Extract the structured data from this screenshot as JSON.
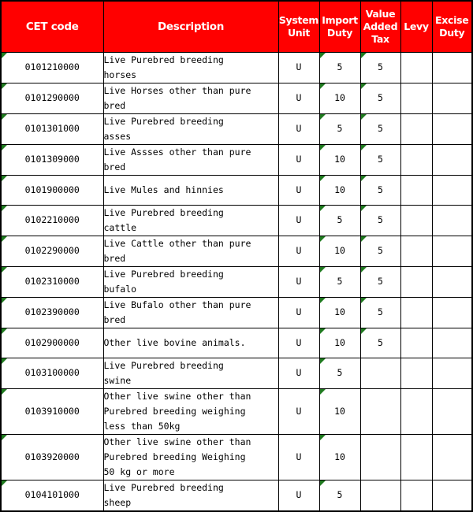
{
  "table": {
    "accent_color": "#FF0000",
    "header_text_color": "#FFFFFF",
    "border_color": "#000000",
    "error_flag_color": "#1F7A1F",
    "columns": [
      {
        "key": "cet_code",
        "label": "CET code"
      },
      {
        "key": "description",
        "label": "Description"
      },
      {
        "key": "system_unit",
        "label": "System Unit"
      },
      {
        "key": "import_duty",
        "label": "Import Duty"
      },
      {
        "key": "vat",
        "label": "Value Added Tax"
      },
      {
        "key": "levy",
        "label": "Levy"
      },
      {
        "key": "excise_duty",
        "label": "Excise Duty"
      }
    ],
    "rows": [
      {
        "cet_code": "0101210000",
        "description": "Live Purebred breeding\nhorses",
        "system_unit": "U",
        "import_duty": "5",
        "vat": "5",
        "levy": "",
        "excise_duty": ""
      },
      {
        "cet_code": "0101290000",
        "description": "Live Horses other than pure\nbred",
        "system_unit": "U",
        "import_duty": "10",
        "vat": "5",
        "levy": "",
        "excise_duty": ""
      },
      {
        "cet_code": "0101301000",
        "description": "Live Purebred breeding\nasses",
        "system_unit": "U",
        "import_duty": "5",
        "vat": "5",
        "levy": "",
        "excise_duty": ""
      },
      {
        "cet_code": "0101309000",
        "description": "Live Assses other than pure\nbred",
        "system_unit": "U",
        "import_duty": "10",
        "vat": "5",
        "levy": "",
        "excise_duty": ""
      },
      {
        "cet_code": "0101900000",
        "description": "Live Mules and hinnies",
        "system_unit": "U",
        "import_duty": "10",
        "vat": "5",
        "levy": "",
        "excise_duty": ""
      },
      {
        "cet_code": "0102210000",
        "description": "Live Purebred breeding\ncattle",
        "system_unit": "U",
        "import_duty": "5",
        "vat": "5",
        "levy": "",
        "excise_duty": ""
      },
      {
        "cet_code": "0102290000",
        "description": "Live Cattle other than pure\nbred",
        "system_unit": "U",
        "import_duty": "10",
        "vat": "5",
        "levy": "",
        "excise_duty": ""
      },
      {
        "cet_code": "0102310000",
        "description": "Live Purebred breeding\nbufalo",
        "system_unit": "U",
        "import_duty": "5",
        "vat": "5",
        "levy": "",
        "excise_duty": ""
      },
      {
        "cet_code": "0102390000",
        "description": "Live Bufalo other than pure\nbred",
        "system_unit": "U",
        "import_duty": "10",
        "vat": "5",
        "levy": "",
        "excise_duty": ""
      },
      {
        "cet_code": "0102900000",
        "description": "Other live bovine animals.",
        "system_unit": "U",
        "import_duty": "10",
        "vat": "5",
        "levy": "",
        "excise_duty": ""
      },
      {
        "cet_code": "0103100000",
        "description": "Live Purebred breeding\nswine",
        "system_unit": "U",
        "import_duty": "5",
        "vat": "",
        "levy": "",
        "excise_duty": ""
      },
      {
        "cet_code": "0103910000",
        "description": "Other live swine other than\nPurebred breeding weighing\nless than 50kg",
        "system_unit": "U",
        "import_duty": "10",
        "vat": "",
        "levy": "",
        "excise_duty": ""
      },
      {
        "cet_code": "0103920000",
        "description": "Other live swine other than\nPurebred breeding Weighing\n50 kg or more",
        "system_unit": "U",
        "import_duty": "10",
        "vat": "",
        "levy": "",
        "excise_duty": ""
      },
      {
        "cet_code": "0104101000",
        "description": "Live Purebred breeding\nsheep",
        "system_unit": "U",
        "import_duty": "5",
        "vat": "",
        "levy": "",
        "excise_duty": ""
      }
    ]
  }
}
